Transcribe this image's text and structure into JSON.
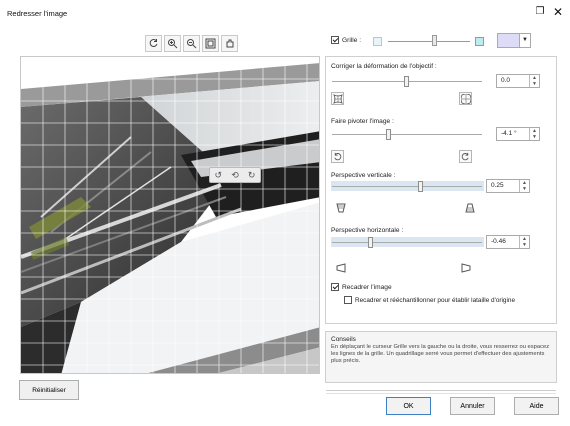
{
  "window": {
    "title": "Redresser l'image",
    "maximize_glyph": "❐",
    "close_glyph": "✕"
  },
  "toolbar": {
    "buttons": [
      {
        "icon": "rotate-icon"
      },
      {
        "icon": "zoom-in-icon"
      },
      {
        "icon": "zoom-out-icon"
      },
      {
        "icon": "fit-icon"
      },
      {
        "icon": "pan-icon"
      }
    ]
  },
  "preview": {
    "overlay_buttons": [
      {
        "icon": "rotate-left-icon",
        "glyph": "↺"
      },
      {
        "icon": "reset-icon",
        "glyph": "⟲"
      },
      {
        "icon": "rotate-right-icon",
        "glyph": "↻"
      }
    ]
  },
  "reset_button": "Réinitialiser",
  "grid": {
    "label": "Grille :",
    "checked": true,
    "color_swatch": "#dcdcf6"
  },
  "lens": {
    "label": "Corriger la déformation de l'objectif :",
    "value": "0.0",
    "slider_position": 0.5,
    "icons": [
      "pincushion-icon",
      "barrel-icon"
    ]
  },
  "rotate": {
    "label": "Faire pivoter l'image :",
    "value": "-4.1 °",
    "slider_position": 0.42,
    "icons": [
      "rotate-left-icon",
      "rotate-right-icon"
    ]
  },
  "vertical": {
    "label": "Perspective verticale :",
    "value": "0.25",
    "slider_position": 0.6,
    "icons": [
      "vertical-narrow-icon",
      "vertical-wide-icon"
    ]
  },
  "horizontal": {
    "label": "Perspective horizontale :",
    "value": "-0.46",
    "slider_position": 0.27,
    "icons": [
      "horizontal-left-icon",
      "horizontal-right-icon"
    ]
  },
  "crop": {
    "label": "Recadrer l'image",
    "checked": true,
    "resample_label": "Recadrer et rééchantillonner pour établir lataille d'origine",
    "resample_checked": false
  },
  "hints": {
    "title": "Conseils",
    "text": "En déplaçant le curseur Grille vers la gauche ou la droite, vous resserrez ou espacez les lignes de la grille. Un quadrillage serré vous permet d'effectuer des ajustements plus précis."
  },
  "buttons": {
    "ok": "OK",
    "cancel": "Annuler",
    "help": "Aide"
  }
}
